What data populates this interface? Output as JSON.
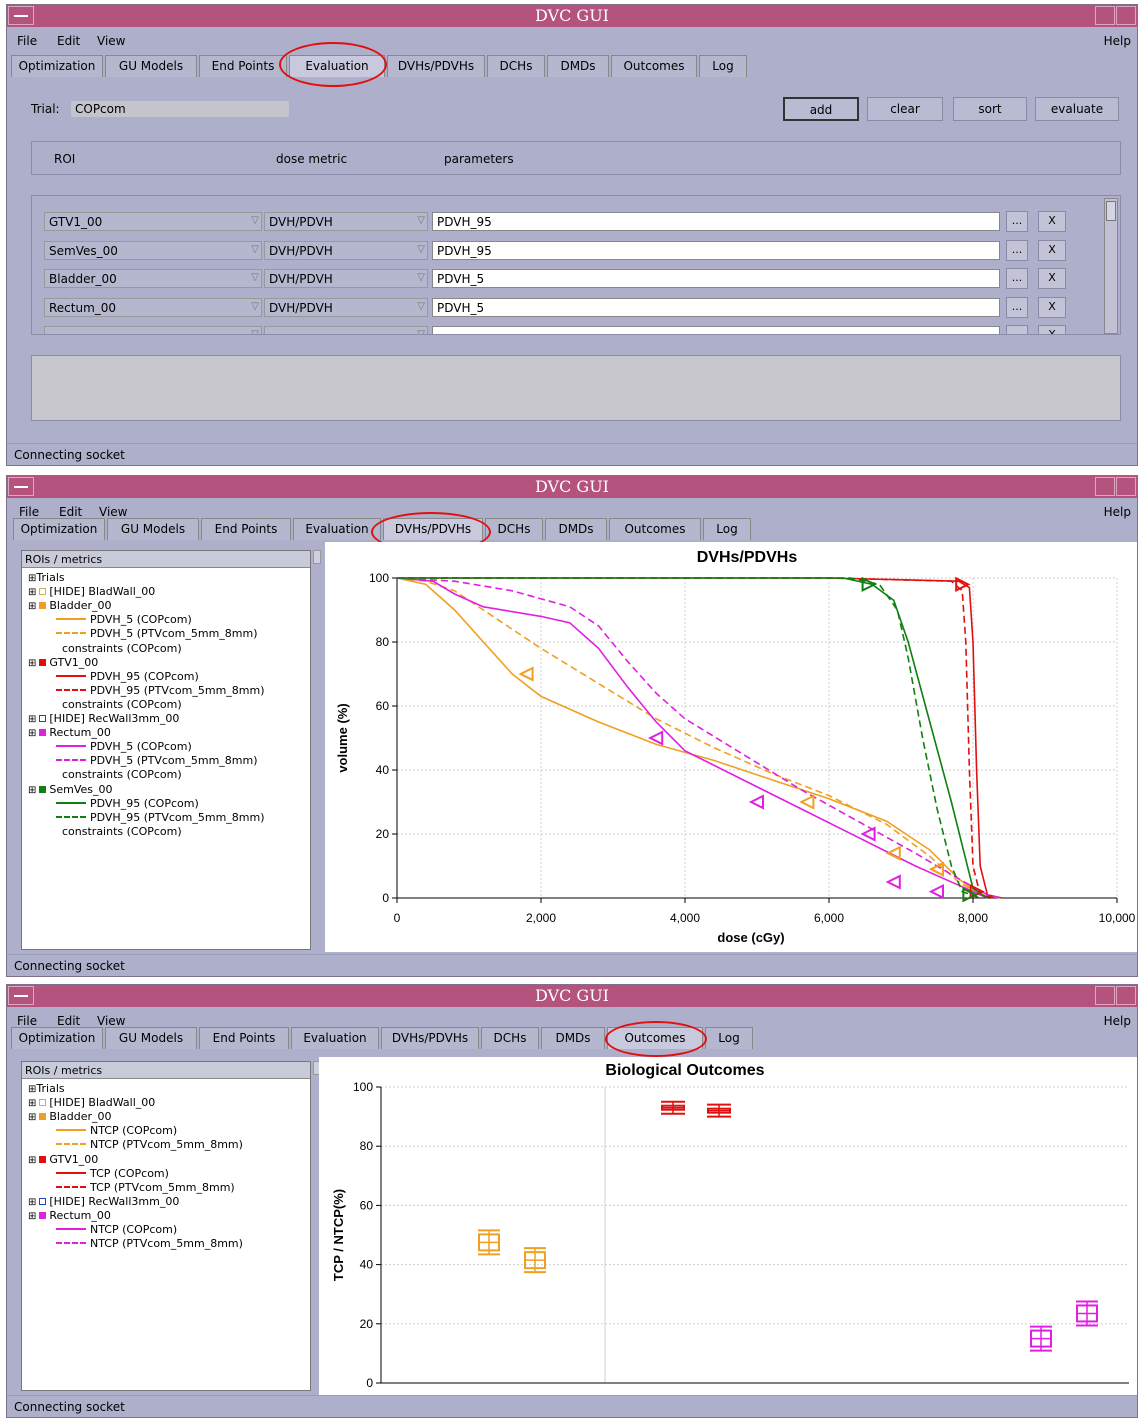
{
  "app_title": "DVC GUI",
  "menus": [
    "File",
    "Edit",
    "View"
  ],
  "help": "Help",
  "tabs": [
    "Optimization",
    "GU Models",
    "End Points",
    "Evaluation",
    "DVHs/PDVHs",
    "DCHs",
    "DMDs",
    "Outcomes",
    "Log"
  ],
  "status": "Connecting socket",
  "evaluation": {
    "trial_label": "Trial:",
    "trial_value": "COPcom",
    "buttons": [
      "add",
      "clear",
      "sort",
      "evaluate"
    ],
    "headers": [
      "ROI",
      "dose metric",
      "parameters"
    ],
    "rows": [
      {
        "roi": "GTV1_00",
        "metric": "DVH/PDVH",
        "param": "PDVH_95"
      },
      {
        "roi": "SemVes_00",
        "metric": "DVH/PDVH",
        "param": "PDVH_95"
      },
      {
        "roi": "Bladder_00",
        "metric": "DVH/PDVH",
        "param": "PDVH_5"
      },
      {
        "roi": "Rectum_00",
        "metric": "DVH/PDVH",
        "param": "PDVH_5"
      },
      {
        "roi": "",
        "metric": "",
        "param": ""
      }
    ],
    "dots": "...",
    "x": "X"
  },
  "dvh_tree": {
    "header": "ROIs / metrics",
    "items": [
      {
        "text": "Trials",
        "kind": "root"
      },
      {
        "text": "[HIDE] BladWall_00",
        "kind": "roi",
        "color": "#c8b060",
        "hollow": true
      },
      {
        "text": "Bladder_00",
        "kind": "roi",
        "color": "#f0a020"
      },
      {
        "text": "PDVH_5 (COPcom)",
        "kind": "curve",
        "color": "#f0a020",
        "dash": false
      },
      {
        "text": "PDVH_5 (PTVcom_5mm_8mm)",
        "kind": "curve",
        "color": "#f0a020",
        "dash": true
      },
      {
        "text": "constraints (COPcom)",
        "kind": "cons"
      },
      {
        "text": "GTV1_00",
        "kind": "roi",
        "color": "#e01010"
      },
      {
        "text": "PDVH_95 (COPcom)",
        "kind": "curve",
        "color": "#e01010",
        "dash": false
      },
      {
        "text": "PDVH_95 (PTVcom_5mm_8mm)",
        "kind": "curve",
        "color": "#e01010",
        "dash": true
      },
      {
        "text": "constraints (COPcom)",
        "kind": "cons"
      },
      {
        "text": "[HIDE] RecWall3mm_00",
        "kind": "roi",
        "color": "#2040d0",
        "hollow": true
      },
      {
        "text": "Rectum_00",
        "kind": "roi",
        "color": "#e020e0"
      },
      {
        "text": "PDVH_5 (COPcom)",
        "kind": "curve",
        "color": "#e020e0",
        "dash": false
      },
      {
        "text": "PDVH_5 (PTVcom_5mm_8mm)",
        "kind": "curve",
        "color": "#e020e0",
        "dash": true
      },
      {
        "text": "constraints (COPcom)",
        "kind": "cons"
      },
      {
        "text": "SemVes_00",
        "kind": "roi",
        "color": "#108010"
      },
      {
        "text": "PDVH_95 (COPcom)",
        "kind": "curve",
        "color": "#108010",
        "dash": false
      },
      {
        "text": "PDVH_95 (PTVcom_5mm_8mm)",
        "kind": "curve",
        "color": "#108010",
        "dash": true
      },
      {
        "text": "constraints (COPcom)",
        "kind": "cons"
      }
    ]
  },
  "outcome_tree": {
    "header": "ROIs / metrics",
    "items": [
      {
        "text": "Trials",
        "kind": "root"
      },
      {
        "text": "[HIDE] BladWall_00",
        "kind": "roi",
        "color": "#c8b060",
        "hollow": true
      },
      {
        "text": "Bladder_00",
        "kind": "roi",
        "color": "#f0a020"
      },
      {
        "text": "NTCP (COPcom)",
        "kind": "curve",
        "color": "#f0a020",
        "dash": false
      },
      {
        "text": "NTCP (PTVcom_5mm_8mm)",
        "kind": "curve",
        "color": "#f0a020",
        "dash": true
      },
      {
        "text": "GTV1_00",
        "kind": "roi",
        "color": "#e01010"
      },
      {
        "text": "TCP (COPcom)",
        "kind": "curve",
        "color": "#e01010",
        "dash": false
      },
      {
        "text": "TCP (PTVcom_5mm_8mm)",
        "kind": "curve",
        "color": "#e01010",
        "dash": true
      },
      {
        "text": "[HIDE] RecWall3mm_00",
        "kind": "roi",
        "color": "#2040d0",
        "hollow": true
      },
      {
        "text": "Rectum_00",
        "kind": "roi",
        "color": "#e020e0"
      },
      {
        "text": "NTCP (COPcom)",
        "kind": "curve",
        "color": "#e020e0",
        "dash": false
      },
      {
        "text": "NTCP (PTVcom_5mm_8mm)",
        "kind": "curve",
        "color": "#e020e0",
        "dash": true
      }
    ]
  },
  "chart_data": [
    {
      "type": "line",
      "title": "DVHs/PDVHs",
      "xlabel": "dose (cGy)",
      "ylabel": "volume (%)",
      "xlim": [
        0,
        10000
      ],
      "ylim": [
        0,
        100
      ],
      "xticks": [
        "0",
        "2,000",
        "4,000",
        "6,000",
        "8,000",
        "10,000"
      ],
      "yticks": [
        "0",
        "20",
        "40",
        "60",
        "80",
        "100"
      ],
      "grid": true,
      "series": [
        {
          "name": "PDVH_5 (COPcom)",
          "color": "#f0a020",
          "dash": false,
          "points": [
            [
              0,
              100
            ],
            [
              400,
              98
            ],
            [
              800,
              90
            ],
            [
              1200,
              80
            ],
            [
              1600,
              70
            ],
            [
              2000,
              63
            ],
            [
              2800,
              55
            ],
            [
              3600,
              48
            ],
            [
              4400,
              43
            ],
            [
              5200,
              37
            ],
            [
              6000,
              31
            ],
            [
              6800,
              24
            ],
            [
              7400,
              15
            ],
            [
              7800,
              6
            ],
            [
              8100,
              1
            ],
            [
              8400,
              0
            ]
          ]
        },
        {
          "name": "PDVH_5 (PTVcom_5mm_8mm)",
          "color": "#f0a020",
          "dash": true,
          "points": [
            [
              0,
              100
            ],
            [
              400,
              99
            ],
            [
              800,
              96
            ],
            [
              1200,
              90
            ],
            [
              1600,
              84
            ],
            [
              2000,
              78
            ],
            [
              2800,
              67
            ],
            [
              3600,
              56
            ],
            [
              4400,
              47
            ],
            [
              5200,
              39
            ],
            [
              6000,
              32
            ],
            [
              6800,
              23
            ],
            [
              7400,
              13
            ],
            [
              7800,
              5
            ],
            [
              8100,
              1
            ],
            [
              8400,
              0
            ]
          ]
        },
        {
          "name": "PDVH_95 (COPcom)",
          "color": "#e01010",
          "dash": false,
          "points": [
            [
              0,
              100
            ],
            [
              6000,
              100
            ],
            [
              7800,
              99
            ],
            [
              7950,
              97
            ],
            [
              8000,
              80
            ],
            [
              8050,
              40
            ],
            [
              8100,
              10
            ],
            [
              8200,
              1
            ],
            [
              8400,
              0
            ]
          ]
        },
        {
          "name": "PDVH_95 (PTVcom_5mm_8mm)",
          "color": "#e01010",
          "dash": true,
          "points": [
            [
              0,
              100
            ],
            [
              6000,
              100
            ],
            [
              7700,
              99
            ],
            [
              7850,
              96
            ],
            [
              7900,
              80
            ],
            [
              7950,
              40
            ],
            [
              8000,
              10
            ],
            [
              8100,
              1
            ],
            [
              8300,
              0
            ]
          ]
        },
        {
          "name": "PDVH_5 (COPcom)",
          "color": "#e020e0",
          "dash": false,
          "points": [
            [
              0,
              100
            ],
            [
              500,
              99
            ],
            [
              800,
              95
            ],
            [
              1200,
              91
            ],
            [
              2000,
              88
            ],
            [
              2400,
              86
            ],
            [
              2800,
              78
            ],
            [
              3200,
              66
            ],
            [
              3600,
              55
            ],
            [
              4000,
              46
            ],
            [
              4800,
              37
            ],
            [
              5600,
              28
            ],
            [
              6400,
              19
            ],
            [
              7200,
              10
            ],
            [
              7800,
              4
            ],
            [
              8200,
              0
            ]
          ]
        },
        {
          "name": "PDVH_5 (PTVcom_5mm_8mm)",
          "color": "#e020e0",
          "dash": true,
          "points": [
            [
              0,
              100
            ],
            [
              800,
              99
            ],
            [
              1600,
              96
            ],
            [
              2400,
              91
            ],
            [
              2800,
              85
            ],
            [
              3200,
              74
            ],
            [
              3600,
              64
            ],
            [
              4000,
              56
            ],
            [
              4800,
              45
            ],
            [
              5600,
              34
            ],
            [
              6400,
              24
            ],
            [
              7200,
              14
            ],
            [
              7800,
              6
            ],
            [
              8200,
              1
            ],
            [
              8400,
              0
            ]
          ]
        },
        {
          "name": "PDVH_95 (COPcom)",
          "color": "#108010",
          "dash": false,
          "points": [
            [
              0,
              100
            ],
            [
              6200,
              100
            ],
            [
              6600,
              98
            ],
            [
              6900,
              93
            ],
            [
              7100,
              80
            ],
            [
              7400,
              55
            ],
            [
              7700,
              30
            ],
            [
              7900,
              12
            ],
            [
              8000,
              3
            ],
            [
              8200,
              0
            ]
          ]
        },
        {
          "name": "PDVH_95 (PTVcom_5mm_8mm)",
          "color": "#108010",
          "dash": true,
          "points": [
            [
              0,
              100
            ],
            [
              6300,
              100
            ],
            [
              6700,
              98
            ],
            [
              6950,
              90
            ],
            [
              7100,
              75
            ],
            [
              7300,
              50
            ],
            [
              7500,
              28
            ],
            [
              7700,
              10
            ],
            [
              7850,
              2
            ],
            [
              8100,
              0
            ]
          ]
        }
      ],
      "markers": [
        {
          "x": 1800,
          "y": 70,
          "color": "#f0a020",
          "dir": "left"
        },
        {
          "x": 5700,
          "y": 30,
          "color": "#f0a020",
          "dir": "left"
        },
        {
          "x": 6900,
          "y": 14,
          "color": "#f0a020",
          "dir": "left"
        },
        {
          "x": 7500,
          "y": 9,
          "color": "#f0a020",
          "dir": "left"
        },
        {
          "x": 3600,
          "y": 50,
          "color": "#e020e0",
          "dir": "left"
        },
        {
          "x": 5000,
          "y": 30,
          "color": "#e020e0",
          "dir": "left"
        },
        {
          "x": 6550,
          "y": 20,
          "color": "#e020e0",
          "dir": "left"
        },
        {
          "x": 6900,
          "y": 5,
          "color": "#e020e0",
          "dir": "left"
        },
        {
          "x": 7500,
          "y": 2,
          "color": "#e020e0",
          "dir": "left"
        },
        {
          "x": 6550,
          "y": 98,
          "color": "#108010",
          "dir": "right"
        },
        {
          "x": 7850,
          "y": 98,
          "color": "#e01010",
          "dir": "right"
        },
        {
          "x": 8050,
          "y": 2,
          "color": "#e01010",
          "dir": "right"
        },
        {
          "x": 7950,
          "y": 1,
          "color": "#108010",
          "dir": "right"
        }
      ]
    },
    {
      "type": "box",
      "title": "Biological Outcomes",
      "xlabel": "",
      "ylabel": "TCP / NTCP(%)",
      "ylim": [
        0,
        100
      ],
      "yticks": [
        "0",
        "20",
        "40",
        "60",
        "80",
        "100"
      ],
      "grid": true,
      "series": [
        {
          "name": "NTCP (COPcom)",
          "color": "#f0a020",
          "values": [
            47.5
          ]
        },
        {
          "name": "NTCP (PTVcom_5mm_8mm)",
          "color": "#f0a020",
          "values": [
            41.5
          ]
        },
        {
          "name": "TCP (COPcom)",
          "color": "#e01010",
          "values": [
            93
          ]
        },
        {
          "name": "TCP (PTVcom_5mm_8mm)",
          "color": "#e01010",
          "values": [
            92
          ]
        },
        {
          "name": "NTCP (COPcom)",
          "color": "#e020e0",
          "values": [
            15
          ]
        },
        {
          "name": "NTCP (PTVcom_5mm_8mm)",
          "color": "#e020e0",
          "values": [
            23.5
          ]
        }
      ]
    }
  ]
}
